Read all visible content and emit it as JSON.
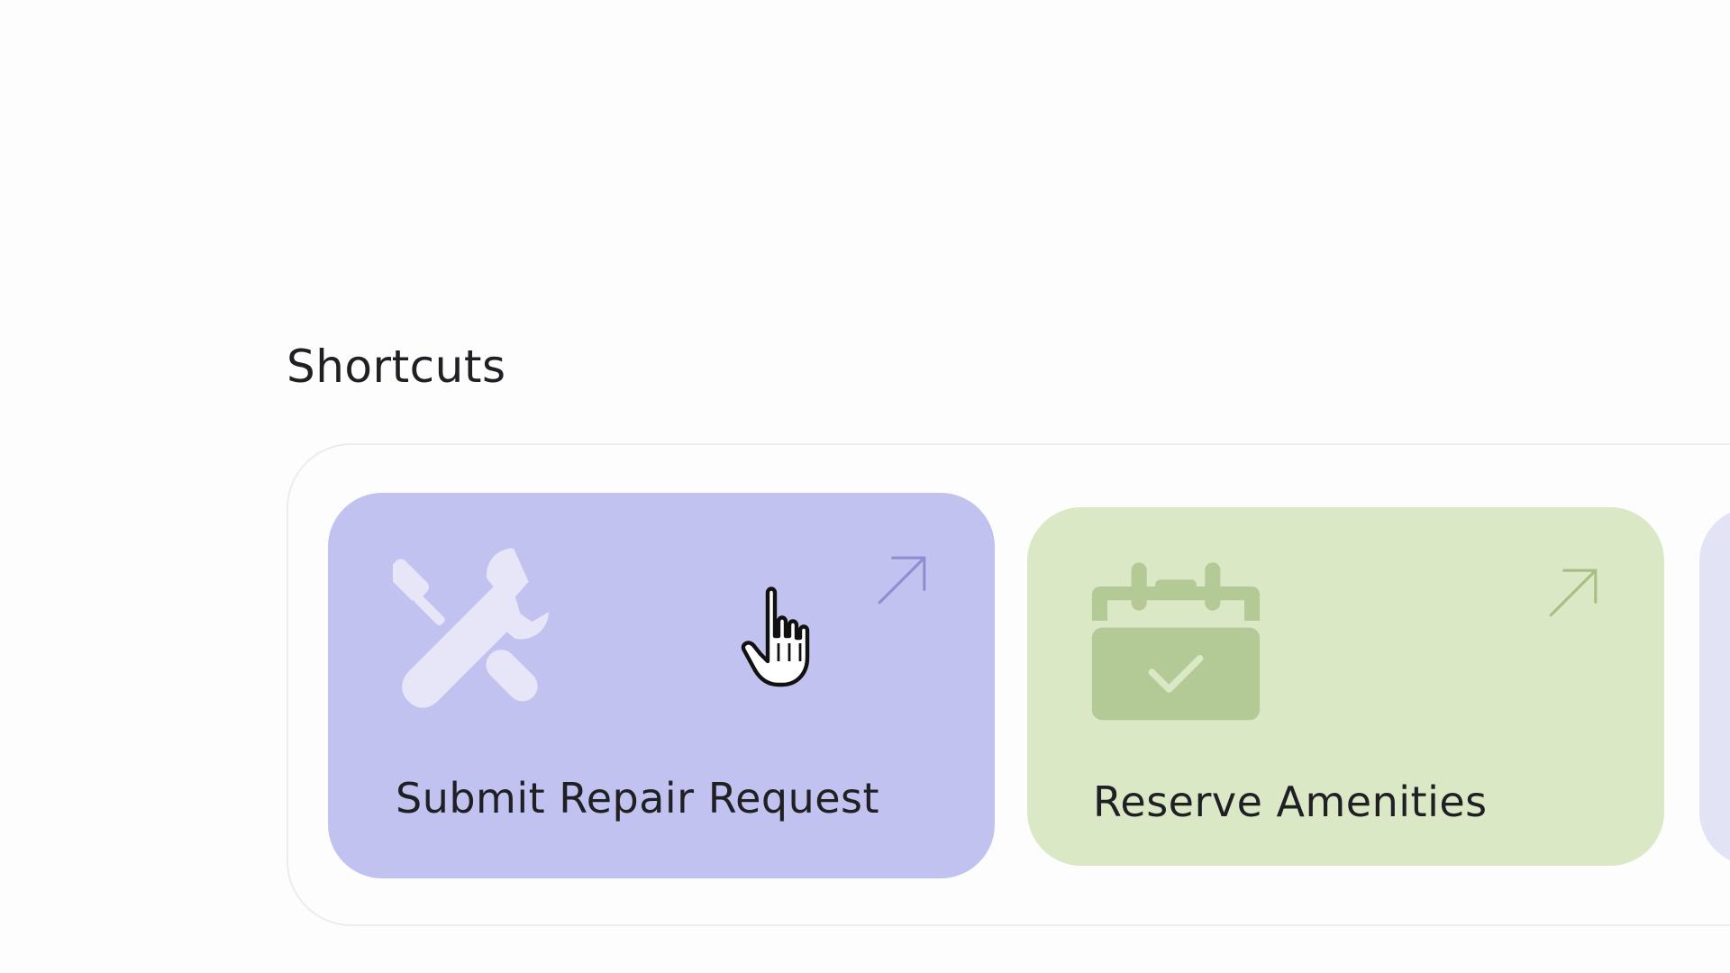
{
  "shortcuts": {
    "title": "Shortcuts",
    "cards": [
      {
        "label": "Submit Repair Request",
        "icon": "tools-icon",
        "action_icon": "arrow-up-right-icon",
        "color": "#c1c2f0"
      },
      {
        "label": "Reserve Amenities",
        "icon": "calendar-check-icon",
        "action_icon": "arrow-up-right-icon",
        "color": "#dbe8c5"
      }
    ]
  },
  "cursor": {
    "icon": "hand-pointer-icon"
  }
}
